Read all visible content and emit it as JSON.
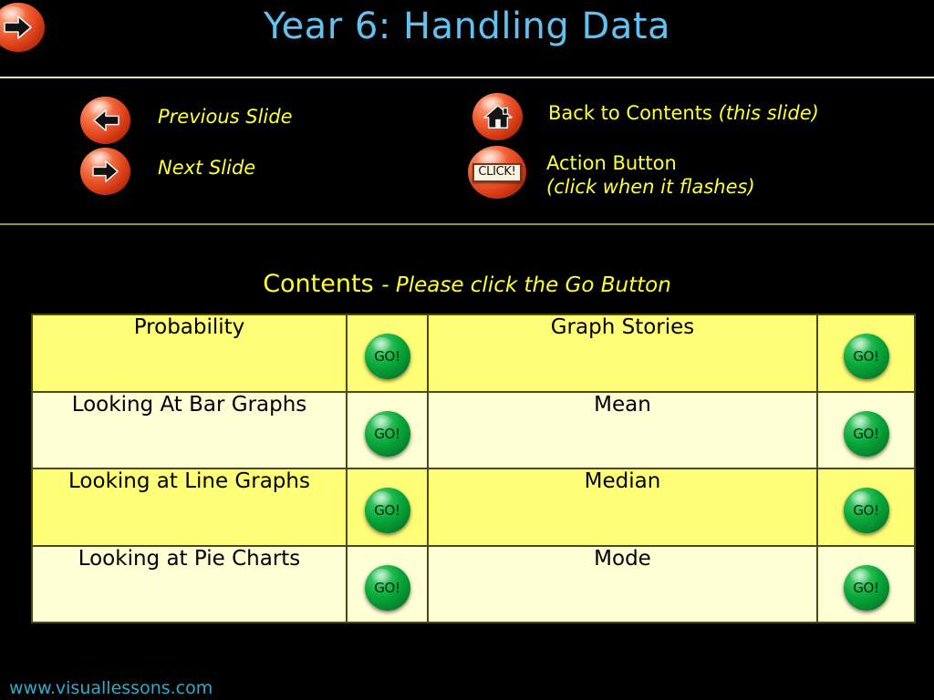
{
  "slide": {
    "title": "Year 6: Handling Data",
    "title_color": "#62c1ee",
    "background_color": "#000000",
    "footer": "www.visuallessons.com",
    "footer_color": "#2eaccc"
  },
  "corner": {
    "icon": "right-arrow-sphere-icon"
  },
  "legend": {
    "text_color": "#ffff33",
    "items": [
      {
        "icon": "left-arrow-icon",
        "label": "Previous Slide",
        "label2": ""
      },
      {
        "icon": "right-arrow-icon",
        "label": "Next Slide",
        "label2": ""
      },
      {
        "icon": "home-icon",
        "label": "Back to Contents ",
        "label2": "(this slide)"
      },
      {
        "icon": "click-button-icon",
        "label": "Action Button",
        "label2": "(click when it flashes)",
        "button_text": "CLICK!"
      }
    ]
  },
  "contents": {
    "heading_main": "Contents ",
    "heading_sub": "- Please click the Go Button",
    "go_label": "GO!",
    "row_color_a": "#ffff77",
    "row_color_b": "#ffffd5",
    "rows": [
      {
        "left_topic": "Probability",
        "left_go": "GO!",
        "right_topic": "Graph Stories",
        "right_go": "GO!"
      },
      {
        "left_topic": "Looking At Bar Graphs",
        "left_go": "GO!",
        "right_topic": "Mean",
        "right_go": "GO!"
      },
      {
        "left_topic": "Looking at Line Graphs",
        "left_go": "GO!",
        "right_topic": "Median",
        "right_go": "GO!"
      },
      {
        "left_topic": "Looking at Pie Charts",
        "left_go": "GO!",
        "right_topic": "Mode",
        "right_go": "GO!"
      }
    ]
  }
}
